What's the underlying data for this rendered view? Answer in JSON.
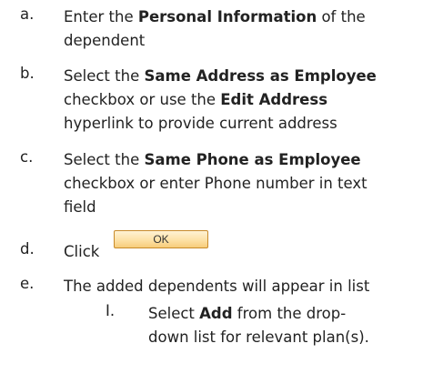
{
  "items": [
    {
      "marker": "a.",
      "lines": [
        [
          {
            "t": "Enter the "
          },
          {
            "t": "Personal Information",
            "b": true
          },
          {
            "t": " of the"
          }
        ],
        [
          {
            "t": "dependent"
          }
        ]
      ]
    },
    {
      "marker": "b.",
      "lines": [
        [
          {
            "t": "Select the "
          },
          {
            "t": "Same Address as Employee",
            "b": true
          }
        ],
        [
          {
            "t": "checkbox or use the "
          },
          {
            "t": "Edit Address",
            "b": true
          }
        ],
        [
          {
            "t": "hyperlink to provide current address"
          }
        ]
      ]
    },
    {
      "marker": "c.",
      "lines": [
        [
          {
            "t": "Select the "
          },
          {
            "t": "Same Phone as Employee",
            "b": true
          }
        ],
        [
          {
            "t": "checkbox or enter Phone number in text"
          }
        ],
        [
          {
            "t": "field"
          }
        ]
      ]
    },
    {
      "marker": "d.",
      "lines": [
        [
          {
            "t": "Click"
          }
        ]
      ]
    },
    {
      "marker": "e.",
      "lines": [
        [
          {
            "t": "The added dependents will appear in list"
          }
        ]
      ]
    }
  ],
  "ok_button_label": "OK",
  "sub_item": {
    "marker": "I.",
    "lines": [
      [
        {
          "t": "Select "
        },
        {
          "t": "Add",
          "b": true
        },
        {
          "t": " from the drop-"
        }
      ],
      [
        {
          "t": "down list for relevant plan(s)."
        }
      ]
    ]
  }
}
